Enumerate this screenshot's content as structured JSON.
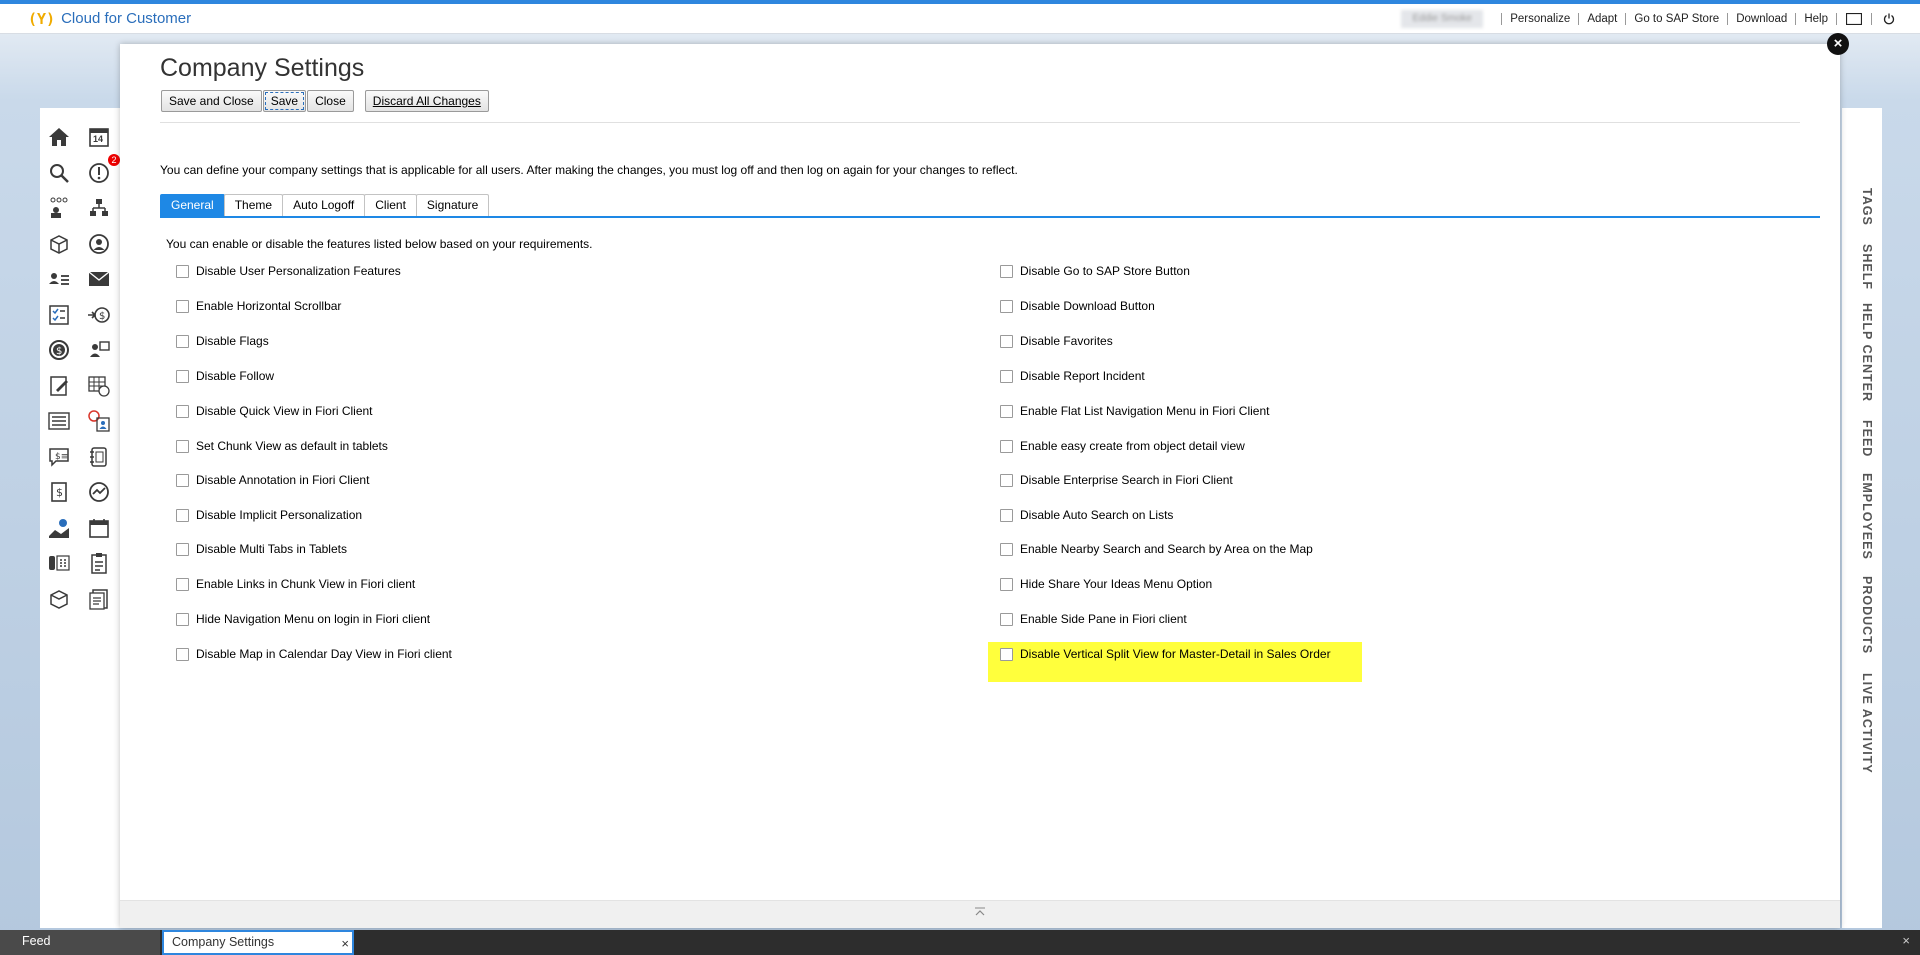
{
  "app": {
    "brand_icon": "(Y)",
    "title": "Cloud for Customer"
  },
  "topnav": {
    "user": "Eddie Smoke",
    "links": [
      "Personalize",
      "Adapt",
      "Go to SAP Store",
      "Download",
      "Help"
    ],
    "icons": [
      "window-icon",
      "power-icon"
    ]
  },
  "left_icons": [
    "home-icon",
    "calendar-icon",
    "search-icon",
    "alert-icon",
    "hierarchy-people-icon",
    "org-chart-icon",
    "boxes-icon",
    "person-circle-icon",
    "person-list-icon",
    "mail-icon",
    "checklist-icon",
    "transfer-money-icon",
    "money-circle-icon",
    "person-money-icon",
    "edit-document-icon",
    "schedule-grid-icon",
    "list-icon",
    "time-person-icon",
    "money-chat-icon",
    "address-book-icon",
    "money-document-icon",
    "money-cycle-icon",
    "map-pin-icon",
    "calendar-small-icon",
    "phone-grid-icon",
    "clipboard-icon",
    "product-box-icon",
    "report-icon"
  ],
  "alert_badge": "2",
  "calendar_day": "14",
  "right_panel": [
    "TAGS",
    "SHELF",
    "HELP CENTER",
    "FEED",
    "EMPLOYEES",
    "PRODUCTS",
    "LIVE ACTIVITY"
  ],
  "dialog": {
    "title": "Company Settings",
    "buttons": {
      "save_and_close": "Save and Close",
      "save": "Save",
      "close": "Close",
      "discard": "Discard All Changes"
    },
    "description": "You can define your company settings that is applicable for all users. After making the changes, you must log off and then log on again for your changes to reflect.",
    "tabs": [
      "General",
      "Theme",
      "Auto Logoff",
      "Client",
      "Signature"
    ],
    "active_tab": "General",
    "sub_description": "You can enable or disable the features listed below based on your requirements.",
    "left_options": [
      "Disable User Personalization Features",
      "Enable Horizontal Scrollbar",
      "Disable Flags",
      "Disable Follow",
      "Disable Quick View in Fiori Client",
      "Set Chunk View as default in tablets",
      "Disable Annotation in Fiori Client",
      "Disable Implicit Personalization",
      "Disable Multi Tabs in Tablets",
      "Enable Links in Chunk View in Fiori client",
      "Hide Navigation Menu on login in Fiori client",
      "Disable Map in Calendar Day View in Fiori client"
    ],
    "right_options": [
      "Disable Go to SAP Store Button",
      "Disable Download Button",
      "Disable Favorites",
      "Disable Report Incident",
      "Enable Flat List Navigation Menu in Fiori Client",
      "Enable easy create from object detail view",
      "Disable Enterprise Search in Fiori Client",
      "Disable Auto Search on Lists",
      "Enable Nearby Search and Search by Area on the Map",
      "Hide Share Your Ideas Menu Option",
      "Enable Side Pane in Fiori client",
      "Disable Vertical Split View for Master-Detail in Sales Order"
    ],
    "highlight_color": "#ffff3c"
  },
  "bottombar": {
    "feed": "Feed",
    "open_tab": "Company Settings"
  },
  "colors": {
    "accent": "#1e88e5",
    "brand": "#2a6ebb",
    "brand_icon": "#f0ab00"
  }
}
